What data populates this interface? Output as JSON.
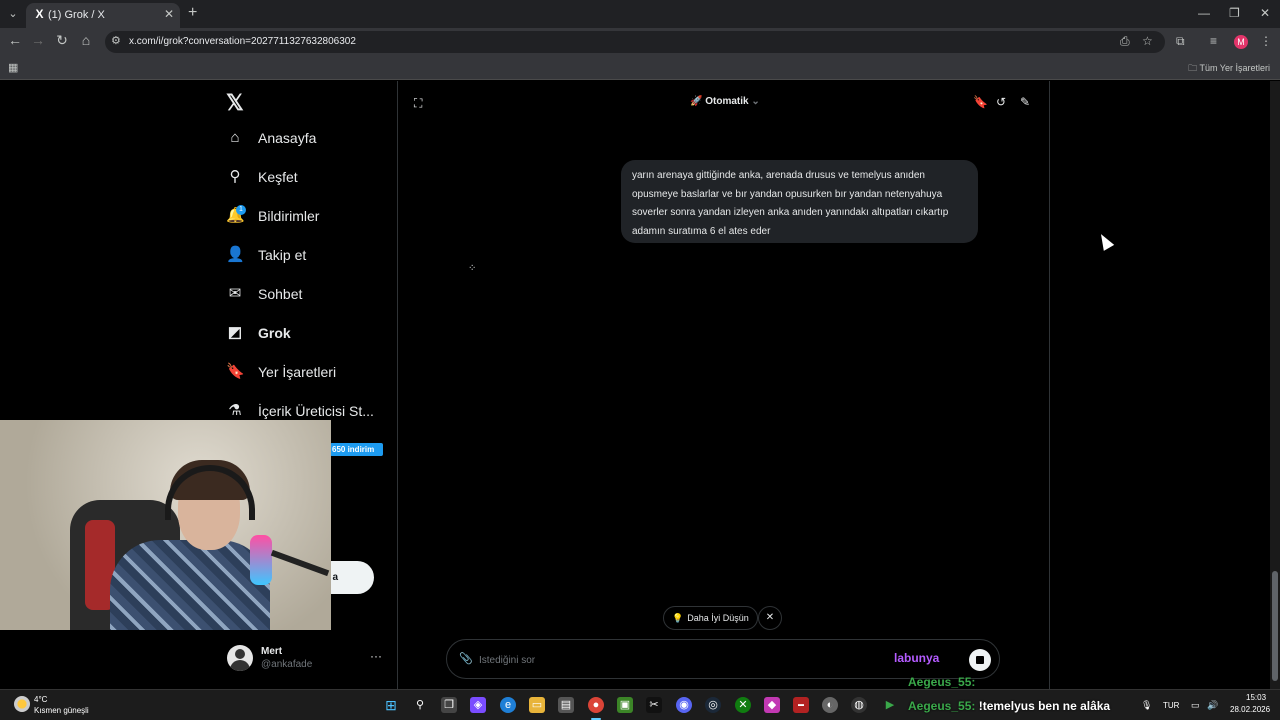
{
  "browser": {
    "tab_title": "(1) Grok / X",
    "tab_favicon": "X",
    "url": "x.com/i/grok?conversation=2027711327632806302",
    "profile_initial": "M",
    "bookmarks_all": "Tüm Yer İşaretleri"
  },
  "sidebar": {
    "logo": "𝕏",
    "items": [
      {
        "label": "Anasayfa",
        "icon": "home-icon",
        "glyph": "⌂"
      },
      {
        "label": "Keşfet",
        "icon": "search-icon",
        "glyph": "⚲"
      },
      {
        "label": "Bildirimler",
        "icon": "bell-icon",
        "glyph": "🔔"
      },
      {
        "label": "Takip et",
        "icon": "add-user-icon",
        "glyph": "👤"
      },
      {
        "label": "Sohbet",
        "icon": "mail-icon",
        "glyph": "✉"
      },
      {
        "label": "Grok",
        "icon": "grok-icon",
        "glyph": "◩"
      },
      {
        "label": "Yer İşaretleri",
        "icon": "bookmark-icon",
        "glyph": "🔖"
      },
      {
        "label": "İçerik Üreticisi St...",
        "icon": "flask-icon",
        "glyph": "⚗"
      }
    ],
    "notification_count": "1",
    "promo_label": "650 indirim",
    "post_button_label": "a",
    "profile": {
      "name": "Mert",
      "handle": "@ankafade"
    }
  },
  "grok": {
    "model_selector": "Otomatik",
    "user_message": "yarın arenaya gittiğinde anka, arenada drusus ve temelyus anıden opusmeye baslarlar ve bır yandan opusurken bır yandan netenyahuya soverler sonra yandan izleyen anka anıden yanındakı altıpatları cıkartıp adamın suratıma 6 el ates eder",
    "suggestion": "Daha İyi Düşün",
    "composer_placeholder": "İstediğini sor"
  },
  "chat_overlay": [
    {
      "user": "labunya",
      "text": "",
      "color": "#b45bff"
    },
    {
      "user": "Aegeus_55:",
      "text": "",
      "color": "#3aa84a"
    },
    {
      "user": "Aegeus_55:",
      "text": "!temelyus ben ne alâka",
      "color": "#3aa84a"
    }
  ],
  "taskbar": {
    "weather_temp": "4°C",
    "weather_desc": "Kısmen güneşli",
    "language": "TUR",
    "time": "15:03",
    "date": "28.02.2026"
  },
  "colors": {
    "accent": "#1d9bf0",
    "background": "#000000",
    "bubble": "#202327"
  }
}
